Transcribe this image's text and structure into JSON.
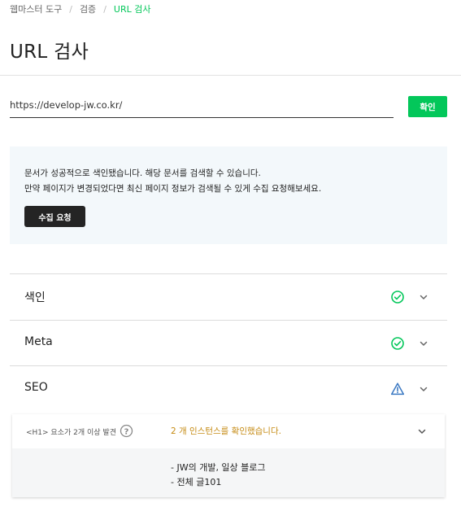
{
  "breadcrumb": {
    "items": [
      "웹마스터 도구",
      "검증"
    ],
    "current": "URL 검사",
    "separator": "/"
  },
  "page": {
    "title": "URL 검사"
  },
  "url_form": {
    "value": "https://develop-jw.co.kr/",
    "confirm_label": "확인"
  },
  "notice": {
    "line1": "문서가 성공적으로 색인됐습니다. 해당 문서를 검색할 수 있습니다.",
    "line2": "만약 페이지가 변경되었다면 최신 페이지 정보가 검색될 수 있게 수집 요청해보세요.",
    "button_label": "수집 요청"
  },
  "sections": [
    {
      "label": "색인",
      "status": "ok",
      "status_icon": "check-circle-icon"
    },
    {
      "label": "Meta",
      "status": "ok",
      "status_icon": "check-circle-icon"
    },
    {
      "label": "SEO",
      "status": "warning",
      "status_icon": "warning-triangle-icon"
    }
  ],
  "seo_detail": {
    "rule_label": "<H1> 요소가 2개 이상 발견",
    "result": "2 개 인스턴스를 확인했습니다.",
    "instances": [
      "- JW의 개발, 일상 블로그",
      "- 전체 글101"
    ]
  },
  "colors": {
    "accent": "#03c75a",
    "ok": "#03c75a",
    "warning_icon": "#3a78c2",
    "result_text": "#c58a12",
    "dark_button": "#242424",
    "notice_bg": "#f3f8fb"
  }
}
